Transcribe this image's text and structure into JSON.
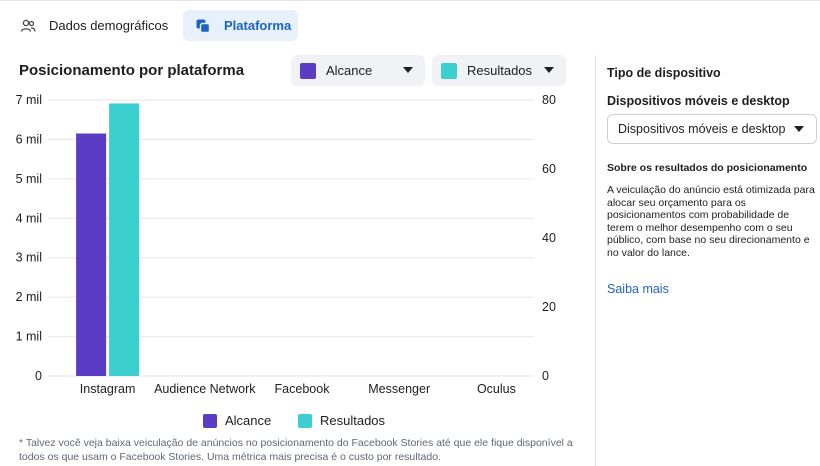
{
  "tabs": {
    "demographics_label": "Dados demográficos",
    "platform_label": "Plataforma"
  },
  "panel": {
    "title": "Posicionamento por plataforma",
    "dropdown_left": "Alcance",
    "dropdown_right": "Resultados"
  },
  "colors": {
    "alcance": "#5b3cc4",
    "resultados": "#3ccfcf",
    "accent": "#1b64c4"
  },
  "chart_data": {
    "type": "bar",
    "categories": [
      "Instagram",
      "Audience Network",
      "Facebook",
      "Messenger",
      "Oculus"
    ],
    "series": [
      {
        "name": "Alcance",
        "axis": "left",
        "values": [
          6150,
          0,
          0,
          0,
          0
        ]
      },
      {
        "name": "Resultados",
        "axis": "right",
        "values": [
          79,
          0,
          0,
          0,
          0
        ]
      }
    ],
    "y_left": {
      "ylim": [
        0,
        7000
      ],
      "ticks": [
        "0",
        "1 mil",
        "2 mil",
        "3 mil",
        "4 mil",
        "5 mil",
        "6 mil",
        "7 mil"
      ]
    },
    "y_right": {
      "ylim": [
        0,
        80
      ],
      "ticks": [
        "0",
        "20",
        "40",
        "60",
        "80"
      ]
    },
    "grid": true,
    "legend": "bottom-center"
  },
  "legend": {
    "alcance": "Alcance",
    "resultados": "Resultados"
  },
  "footnote": "* Talvez você veja baixa veiculação de anúncios no posicionamento do Facebook Stories até que ele fique disponível a todos os que usam o Facebook Stories. Uma métrica mais precisa é o custo por resultado.",
  "sidebar": {
    "heading": "Tipo de dispositivo",
    "subheading": "Dispositivos móveis e desktop",
    "select_value": "Dispositivos móveis e desktop",
    "about_heading": "Sobre os resultados do posicionamento",
    "about_text": "A veiculação do anúncio está otimizada para alocar seu orçamento para os posicionamentos com probabilidade de terem o melhor desempenho com o seu público, com base no seu direcionamento e no valor do lance.",
    "link": "Saiba mais"
  }
}
